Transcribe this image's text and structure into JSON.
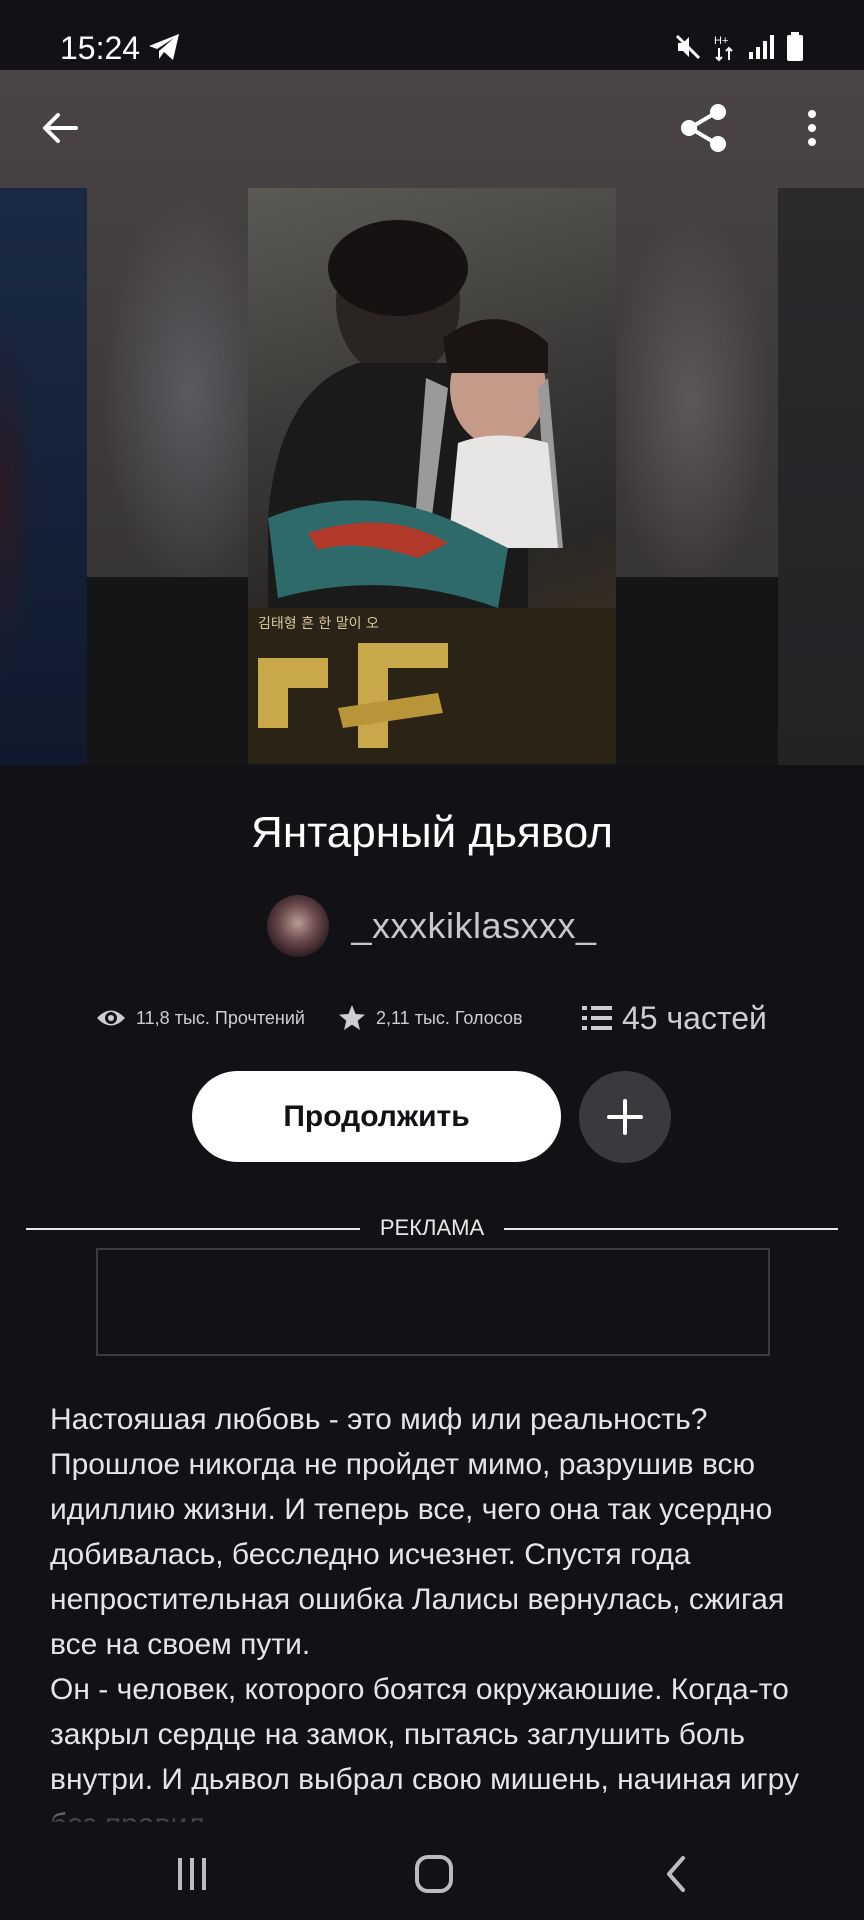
{
  "status_bar": {
    "time": "15:24",
    "icons": [
      "telegram-icon",
      "mute-icon",
      "data-transfer-icon",
      "signal-icon",
      "battery-icon"
    ]
  },
  "top_bar": {
    "icons": [
      "back-arrow-icon",
      "share-icon",
      "more-vertical-icon"
    ]
  },
  "story": {
    "title": "Янтарный дьявол",
    "author": "_xxxkiklasxxx_",
    "cover_text": "김태형 흔 한 말이 오"
  },
  "stats": {
    "reads": "11,8 тыс. Прочтений",
    "votes": "2,11 тыс. Голосов",
    "parts": "45 частей"
  },
  "actions": {
    "continue_label": "Продолжить"
  },
  "ad": {
    "label": "РЕКЛАМА"
  },
  "description": "Настояшая любовь - это миф или реальность?\nПрошлое никогда не пройдет мимо, разрушив всю идиллию жизни. И теперь все, чего она так усердно добивалась, бесследно исчезнет. Спустя года непростительная ошибка Лалисы вернулась, сжигая все на своем пути.\nОн - человек, которого боятся окружаюшие. Когда-то закрыл сердце на замок, пытаясь заглушить боль внутри. И дьявол выбрал свою мишень, начиная игру без правил.",
  "nav": {
    "icons": [
      "recent-apps-icon",
      "home-icon",
      "back-icon"
    ]
  },
  "colors": {
    "background": "#121115",
    "button_primary": "#ffffff",
    "button_secondary": "#3a393d"
  }
}
